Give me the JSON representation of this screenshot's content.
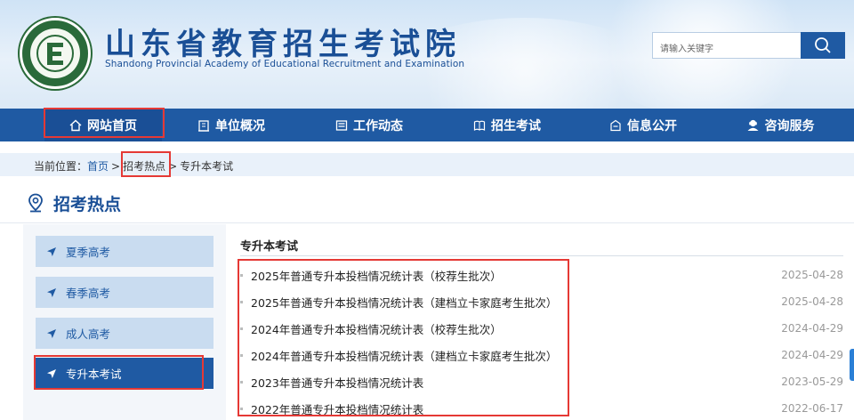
{
  "header": {
    "title": "山东省教育招生考试院",
    "subtitle": "Shandong Provincial Academy of Educational Recruitment and Examination",
    "search_placeholder": "请输入关键字",
    "logo_icon": "exam-academy-logo-icon",
    "search_icon": "search-icon"
  },
  "nav": {
    "items": [
      {
        "label": "网站首页",
        "icon": "home-icon",
        "active": true
      },
      {
        "label": "单位概况",
        "icon": "building-icon"
      },
      {
        "label": "工作动态",
        "icon": "news-icon"
      },
      {
        "label": "招生考试",
        "icon": "book-icon"
      },
      {
        "label": "信息公开",
        "icon": "info-box-icon"
      },
      {
        "label": "咨询服务",
        "icon": "consult-icon"
      }
    ]
  },
  "breadcrumb": {
    "prefix": "当前位置：",
    "items": [
      "首页",
      "招考热点",
      "专升本考试"
    ],
    "separator": ">"
  },
  "section": {
    "title": "招考热点",
    "icon": "location-pin-icon"
  },
  "sidebar": {
    "items": [
      {
        "label": "夏季高考"
      },
      {
        "label": "春季高考"
      },
      {
        "label": "成人高考"
      },
      {
        "label": "专升本考试",
        "active": true
      }
    ],
    "item_icon": "navigation-arrow-icon"
  },
  "content": {
    "heading": "专升本考试",
    "rows": [
      {
        "title": "2025年普通专升本投档情况统计表（校荐生批次）",
        "date": "2025-04-28"
      },
      {
        "title": "2025年普通专升本投档情况统计表（建档立卡家庭考生批次）",
        "date": "2025-04-28"
      },
      {
        "title": "2024年普通专升本投档情况统计表（校荐生批次）",
        "date": "2024-04-29"
      },
      {
        "title": "2024年普通专升本投档情况统计表（建档立卡家庭考生批次）",
        "date": "2024-04-29"
      },
      {
        "title": "2023年普通专升本投档情况统计表",
        "date": "2023-05-29"
      },
      {
        "title": "2022年普通专升本投档情况统计表",
        "date": "2022-06-17"
      }
    ]
  },
  "colors": {
    "primary": "#1f5aa3",
    "title_blue": "#1a4f96",
    "highlight_red": "#e53935",
    "sidebar_item_bg": "#c9dcf0",
    "breadcrumb_bg": "#e9f1fa"
  }
}
